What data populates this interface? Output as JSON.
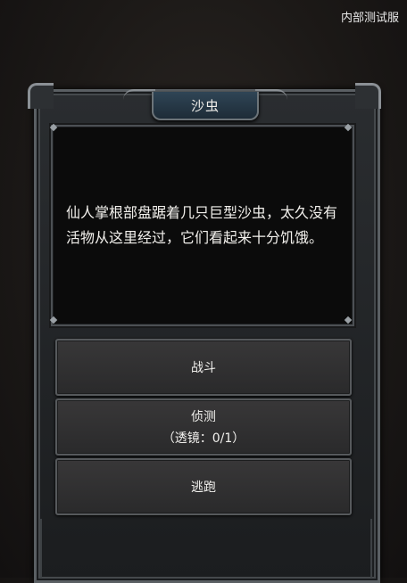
{
  "server_tag": "内部测试服",
  "dialog": {
    "title": "沙虫",
    "description": "仙人掌根部盘踞着几只巨型沙虫，太久没有活物从这里经过，它们看起来十分饥饿。"
  },
  "options": [
    {
      "label": "战斗",
      "sub": ""
    },
    {
      "label": "侦测",
      "sub": "（透镜：0/1）"
    },
    {
      "label": "逃跑",
      "sub": ""
    }
  ],
  "colors": {
    "title_bar": "#2f4556",
    "panel_border": "#5a5f63",
    "text": "#f2f0ec"
  }
}
